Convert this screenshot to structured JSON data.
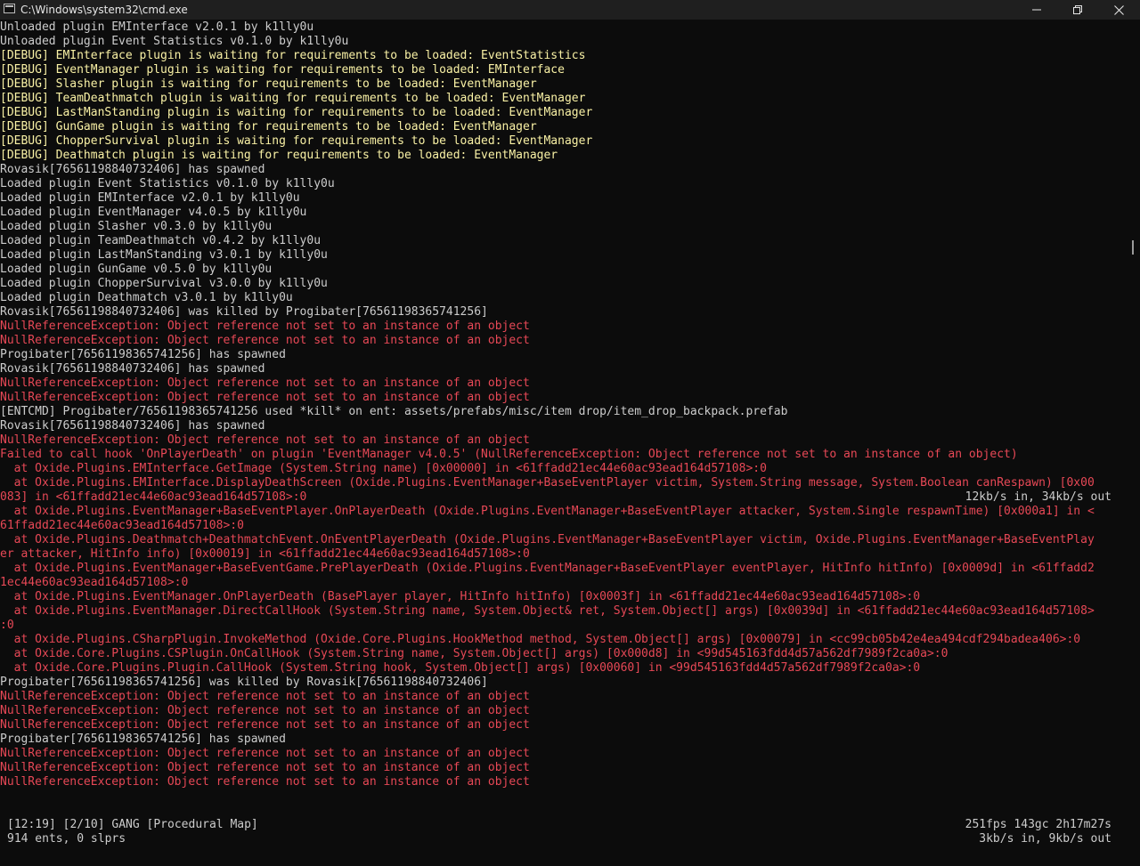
{
  "window": {
    "title": "C:\\Windows\\system32\\cmd.exe",
    "icon": "console-app-icon",
    "buttons": {
      "minimize": "—",
      "maximize": "❐",
      "close": "✕"
    }
  },
  "colors": {
    "background": "#0c0c0c",
    "normal_text": "#cccccc",
    "debug_text": "#f9f1a5",
    "error_text": "#e74856"
  },
  "console": {
    "lines": [
      {
        "text": "Unloaded plugin EMInterface v2.0.1 by k1lly0u",
        "type": "normal"
      },
      {
        "text": "Unloaded plugin Event Statistics v0.1.0 by k1lly0u",
        "type": "normal"
      },
      {
        "text": "[DEBUG] EMInterface plugin is waiting for requirements to be loaded: EventStatistics",
        "type": "debug"
      },
      {
        "text": "[DEBUG] EventManager plugin is waiting for requirements to be loaded: EMInterface",
        "type": "debug"
      },
      {
        "text": "[DEBUG] Slasher plugin is waiting for requirements to be loaded: EventManager",
        "type": "debug"
      },
      {
        "text": "[DEBUG] TeamDeathmatch plugin is waiting for requirements to be loaded: EventManager",
        "type": "debug"
      },
      {
        "text": "[DEBUG] LastManStanding plugin is waiting for requirements to be loaded: EventManager",
        "type": "debug"
      },
      {
        "text": "[DEBUG] GunGame plugin is waiting for requirements to be loaded: EventManager",
        "type": "debug"
      },
      {
        "text": "[DEBUG] ChopperSurvival plugin is waiting for requirements to be loaded: EventManager",
        "type": "debug"
      },
      {
        "text": "[DEBUG] Deathmatch plugin is waiting for requirements to be loaded: EventManager",
        "type": "debug"
      },
      {
        "text": "Rovasik[76561198840732406] has spawned",
        "type": "normal"
      },
      {
        "text": "Loaded plugin Event Statistics v0.1.0 by k1lly0u",
        "type": "normal"
      },
      {
        "text": "Loaded plugin EMInterface v2.0.1 by k1lly0u",
        "type": "normal"
      },
      {
        "text": "Loaded plugin EventManager v4.0.5 by k1lly0u",
        "type": "normal"
      },
      {
        "text": "Loaded plugin Slasher v0.3.0 by k1lly0u",
        "type": "normal"
      },
      {
        "text": "Loaded plugin TeamDeathmatch v0.4.2 by k1lly0u",
        "type": "normal"
      },
      {
        "text": "Loaded plugin LastManStanding v3.0.1 by k1lly0u",
        "type": "normal"
      },
      {
        "text": "Loaded plugin GunGame v0.5.0 by k1lly0u",
        "type": "normal"
      },
      {
        "text": "Loaded plugin ChopperSurvival v3.0.0 by k1lly0u",
        "type": "normal"
      },
      {
        "text": "Loaded plugin Deathmatch v3.0.1 by k1lly0u",
        "type": "normal"
      },
      {
        "text": "Rovasik[76561198840732406] was killed by Progibater[76561198365741256]",
        "type": "normal"
      },
      {
        "text": "NullReferenceException: Object reference not set to an instance of an object",
        "type": "error"
      },
      {
        "text": "NullReferenceException: Object reference not set to an instance of an object",
        "type": "error"
      },
      {
        "text": "Progibater[76561198365741256] has spawned",
        "type": "normal"
      },
      {
        "text": "Rovasik[76561198840732406] has spawned",
        "type": "normal"
      },
      {
        "text": "NullReferenceException: Object reference not set to an instance of an object",
        "type": "error"
      },
      {
        "text": "NullReferenceException: Object reference not set to an instance of an object",
        "type": "error"
      },
      {
        "text": "[ENTCMD] Progibater/76561198365741256 used *kill* on ent: assets/prefabs/misc/item drop/item_drop_backpack.prefab",
        "type": "normal"
      },
      {
        "text": "Rovasik[76561198840732406] has spawned",
        "type": "normal"
      },
      {
        "text": "NullReferenceException: Object reference not set to an instance of an object",
        "type": "error"
      },
      {
        "text": "Failed to call hook 'OnPlayerDeath' on plugin 'EventManager v4.0.5' (NullReferenceException: Object reference not set to an instance of an object)",
        "type": "error"
      },
      {
        "text": "  at Oxide.Plugins.EMInterface.GetImage (System.String name) [0x00000] in <61ffadd21ec44e60ac93ead164d57108>:0",
        "type": "error"
      },
      {
        "text": "  at Oxide.Plugins.EMInterface.DisplayDeathScreen (Oxide.Plugins.EventManager+BaseEventPlayer victim, System.String message, System.Boolean canRespawn) [0x00",
        "type": "error"
      },
      {
        "text": "083] in <61ffadd21ec44e60ac93ead164d57108>:0",
        "type": "error"
      },
      {
        "text": "  at Oxide.Plugins.EventManager+BaseEventPlayer.OnPlayerDeath (Oxide.Plugins.EventManager+BaseEventPlayer attacker, System.Single respawnTime) [0x000a1] in <",
        "type": "error"
      },
      {
        "text": "61ffadd21ec44e60ac93ead164d57108>:0",
        "type": "error"
      },
      {
        "text": "  at Oxide.Plugins.Deathmatch+DeathmatchEvent.OnEventPlayerDeath (Oxide.Plugins.EventManager+BaseEventPlayer victim, Oxide.Plugins.EventManager+BaseEventPlay",
        "type": "error"
      },
      {
        "text": "er attacker, HitInfo info) [0x00019] in <61ffadd21ec44e60ac93ead164d57108>:0",
        "type": "error"
      },
      {
        "text": "  at Oxide.Plugins.EventManager+BaseEventGame.PrePlayerDeath (Oxide.Plugins.EventManager+BaseEventPlayer eventPlayer, HitInfo hitInfo) [0x0009d] in <61ffadd2",
        "type": "error"
      },
      {
        "text": "1ec44e60ac93ead164d57108>:0",
        "type": "error"
      },
      {
        "text": "  at Oxide.Plugins.EventManager.OnPlayerDeath (BasePlayer player, HitInfo hitInfo) [0x0003f] in <61ffadd21ec44e60ac93ead164d57108>:0",
        "type": "error"
      },
      {
        "text": "  at Oxide.Plugins.EventManager.DirectCallHook (System.String name, System.Object& ret, System.Object[] args) [0x0039d] in <61ffadd21ec44e60ac93ead164d57108>",
        "type": "error"
      },
      {
        "text": ":0",
        "type": "error"
      },
      {
        "text": "  at Oxide.Plugins.CSharpPlugin.InvokeMethod (Oxide.Core.Plugins.HookMethod method, System.Object[] args) [0x00079] in <cc99cb05b42e4ea494cdf294badea406>:0",
        "type": "error"
      },
      {
        "text": "  at Oxide.Core.Plugins.CSPlugin.OnCallHook (System.String name, System.Object[] args) [0x000d8] in <99d545163fdd4d57a562df7989f2ca0a>:0",
        "type": "error"
      },
      {
        "text": "  at Oxide.Core.Plugins.Plugin.CallHook (System.String hook, System.Object[] args) [0x00060] in <99d545163fdd4d57a562df7989f2ca0a>:0",
        "type": "error"
      },
      {
        "text": "Progibater[76561198365741256] was killed by Rovasik[76561198840732406]",
        "type": "normal"
      },
      {
        "text": "NullReferenceException: Object reference not set to an instance of an object",
        "type": "error"
      },
      {
        "text": "NullReferenceException: Object reference not set to an instance of an object",
        "type": "error"
      },
      {
        "text": "NullReferenceException: Object reference not set to an instance of an object",
        "type": "error"
      },
      {
        "text": "Progibater[76561198365741256] has spawned",
        "type": "normal"
      },
      {
        "text": "NullReferenceException: Object reference not set to an instance of an object",
        "type": "error"
      },
      {
        "text": "NullReferenceException: Object reference not set to an instance of an object",
        "type": "error"
      },
      {
        "text": "NullReferenceException: Object reference not set to an instance of an object",
        "type": "error"
      }
    ],
    "netstat_overlay": "12kb/s in, 34kb/s out"
  },
  "status": {
    "server_line": "[12:19] [2/10] GANG [Procedural Map]",
    "entities_line": "914 ents, 0 slprs",
    "perf_line": "251fps 143gc 2h17m27s",
    "net_line": "3kb/s in, 9kb/s out"
  }
}
